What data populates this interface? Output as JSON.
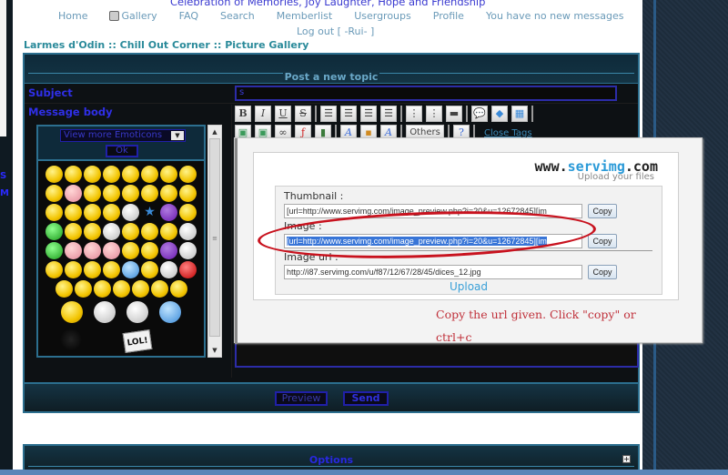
{
  "site": {
    "title": "Celebration of Memories, Joy Laughter, Hope and Friendship"
  },
  "nav": {
    "items": [
      "Home",
      "Gallery",
      "FAQ",
      "Search",
      "Memberlist",
      "Usergroups",
      "Profile",
      "You have no new messages"
    ],
    "gallery_icon": "gallery-icon",
    "logout": "Log out [ -Rui- ]"
  },
  "breadcrumb": "Larmes d'Odin  :: Chill Out Corner :: Picture Gallery",
  "form": {
    "heading": "Post a new topic",
    "subject_label": "Subject",
    "subject_value": "s",
    "message_label": "Message body",
    "emoticons": {
      "select_value": "View more Emoticons",
      "ok_label": "Ok",
      "lol_label": "LOL!"
    },
    "toolbar": {
      "row1": [
        "B",
        "I",
        "U",
        "S"
      ],
      "others_label": "Others",
      "close_tags_label": "Close Tags"
    },
    "preview_label": "Preview",
    "send_label": "Send"
  },
  "options": {
    "title": "Options",
    "toggle": "+"
  },
  "popup": {
    "logo_left": "www.",
    "logo_mid": "servimg",
    "logo_right": ".com",
    "logo_sub": "Upload your files",
    "thumbnail_label": "Thumbnail :",
    "thumbnail_value": "[url=http://www.servimg.com/image_preview.php?i=20&u=12672845][im",
    "image_label": "Image :",
    "image_value": "[url=http://www.servimg.com/image_preview.php?i=20&u=12672845][im",
    "image_url_label": "Image url :",
    "image_url_value": "http://i87.servimg.com/u/f87/12/67/28/45/dices_12.jpg",
    "copy_label": "Copy",
    "upload_label": "Upload"
  },
  "annotation": {
    "note": "Copy the url given. Click \"copy\"  or ctrl+c",
    "color": "#c8121e"
  },
  "colors": {
    "accent_blue": "#2f2fe8",
    "panel_border": "#2c6f8f",
    "link_teal": "#2a8a9a"
  }
}
